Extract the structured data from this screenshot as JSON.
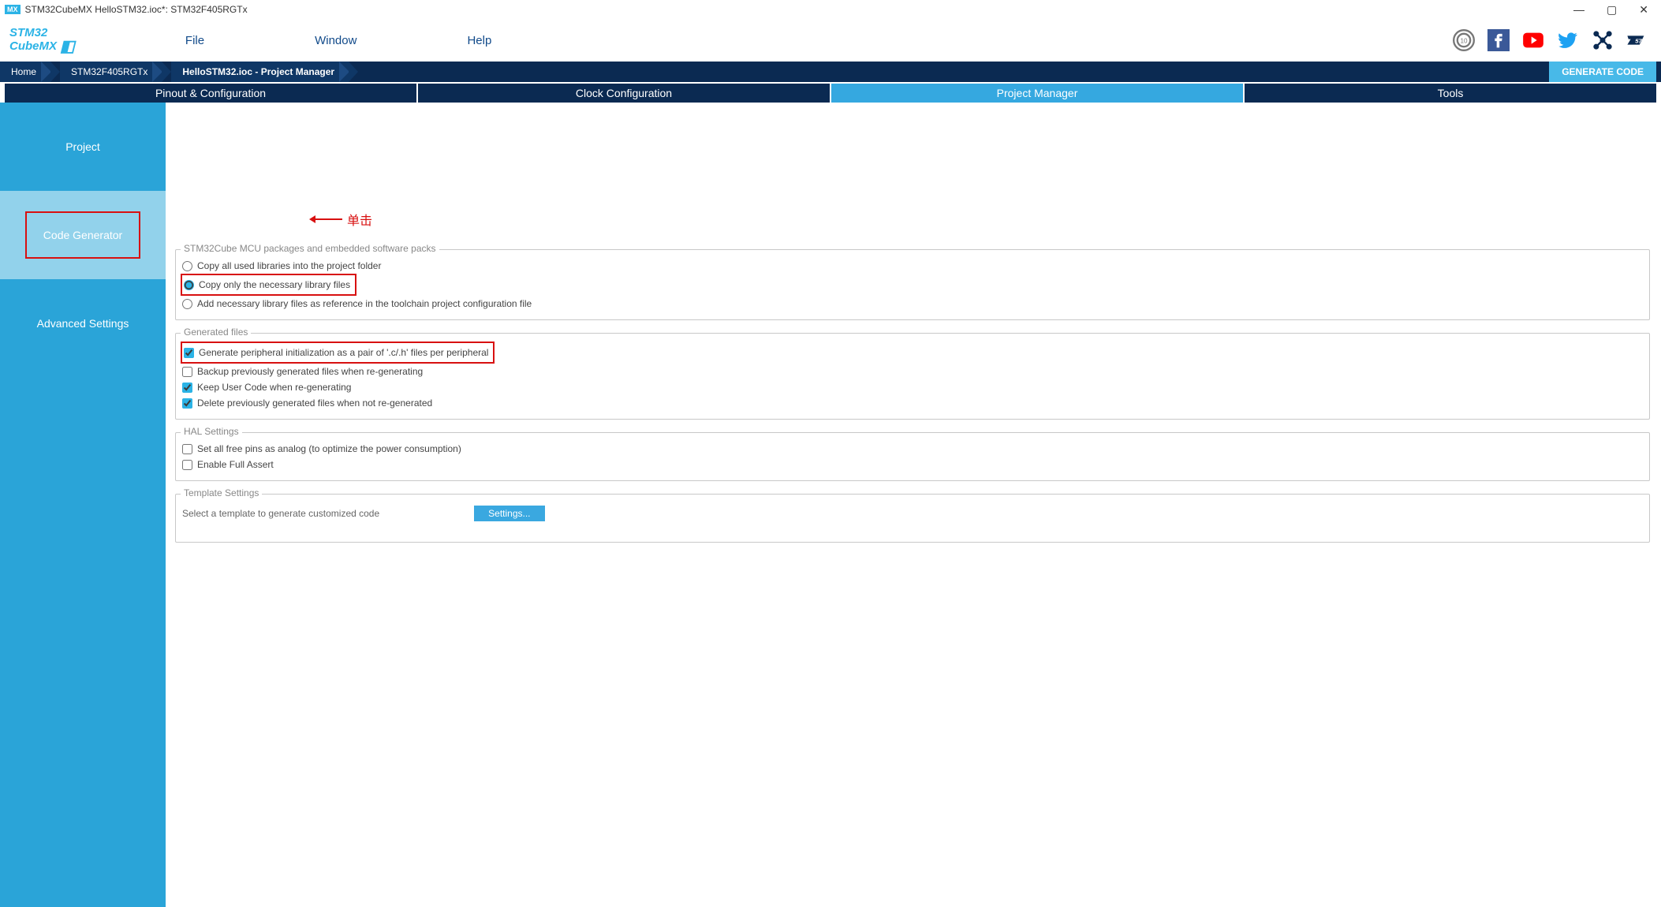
{
  "window": {
    "app_badge": "MX",
    "title": "STM32CubeMX HelloSTM32.ioc*: STM32F405RGTx"
  },
  "logo": {
    "line1": "STM32",
    "line2": "CubeMX"
  },
  "menu": {
    "file": "File",
    "window": "Window",
    "help": "Help"
  },
  "breadcrumb": {
    "home": "Home",
    "chip": "STM32F405RGTx",
    "project": "HelloSTM32.ioc - Project Manager"
  },
  "generate_btn": "GENERATE CODE",
  "main_tabs": {
    "pinout": "Pinout & Configuration",
    "clock": "Clock Configuration",
    "pm": "Project Manager",
    "tools": "Tools"
  },
  "sidebar": {
    "project": "Project",
    "codegen": "Code Generator",
    "advanced": "Advanced Settings"
  },
  "annotation": {
    "label": "单击"
  },
  "groups": {
    "packages": {
      "title": "STM32Cube MCU packages and embedded software packs",
      "opts": {
        "copy_all": "Copy all used libraries into the project folder",
        "copy_necessary": "Copy only the necessary library files",
        "add_ref": "Add necessary library files as reference in the toolchain project configuration file"
      }
    },
    "generated": {
      "title": "Generated files",
      "opts": {
        "pair": "Generate peripheral initialization as a pair of '.c/.h' files per peripheral",
        "backup": "Backup previously generated files when re-generating",
        "keep_user": "Keep User Code when re-generating",
        "delete_prev": "Delete previously generated files when not re-generated"
      }
    },
    "hal": {
      "title": "HAL Settings",
      "opts": {
        "analog": "Set all free pins as analog (to optimize the power consumption)",
        "full_assert": "Enable Full Assert"
      }
    },
    "template": {
      "title": "Template Settings",
      "desc": "Select a template to generate customized code",
      "btn": "Settings..."
    }
  }
}
